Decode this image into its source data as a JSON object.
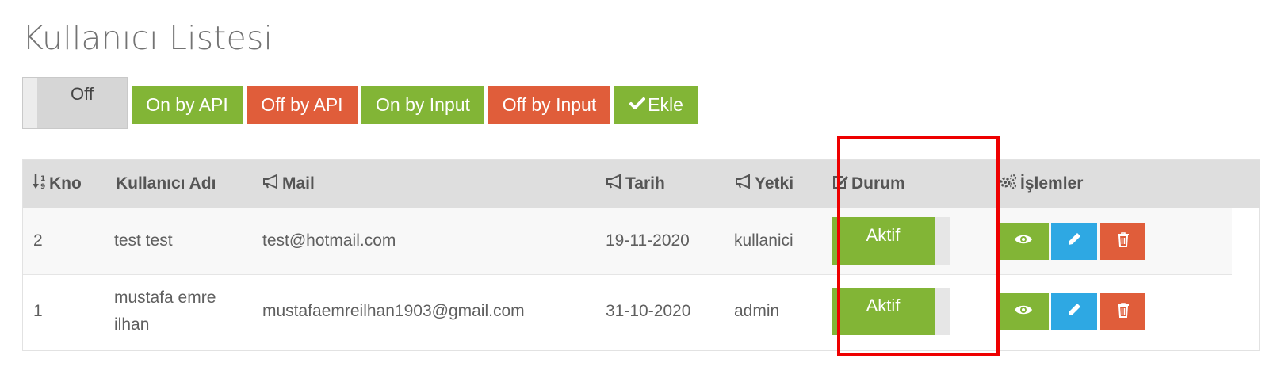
{
  "page": {
    "title": "Kullanıcı Listesi"
  },
  "toolbar": {
    "toggle_label": "Off",
    "buttons": {
      "on_by_api": "On by API",
      "off_by_api": "Off by API",
      "on_by_input": "On by Input",
      "off_by_input": "Off by Input",
      "add": "Ekle"
    }
  },
  "table": {
    "headers": {
      "kno": "Kno",
      "username": "Kullanıcı Adı",
      "mail": "Mail",
      "date": "Tarih",
      "role": "Yetki",
      "status": "Durum",
      "actions": "İşlemler"
    },
    "rows": [
      {
        "kno": "2",
        "username": "test test",
        "mail": "test@hotmail.com",
        "date": "19-11-2020",
        "role": "kullanici",
        "status": "Aktif"
      },
      {
        "kno": "1",
        "username": "mustafa emre ilhan",
        "mail": "mustafaemreilhan1903@gmail.com",
        "date": "31-10-2020",
        "role": "admin",
        "status": "Aktif"
      }
    ]
  },
  "colors": {
    "green": "#82b536",
    "red": "#e05d3a",
    "blue": "#2ea8e3",
    "header_bg": "#dedede",
    "highlight": "#ee0000"
  },
  "icons": {
    "sort": "sort-numeric-icon",
    "mail": "megaphone-icon",
    "date": "megaphone-icon",
    "role": "megaphone-icon",
    "status": "edit-square-icon",
    "actions": "gears-icon",
    "view": "eye-icon",
    "edit": "pencil-icon",
    "delete": "trash-icon",
    "add": "check-icon"
  }
}
